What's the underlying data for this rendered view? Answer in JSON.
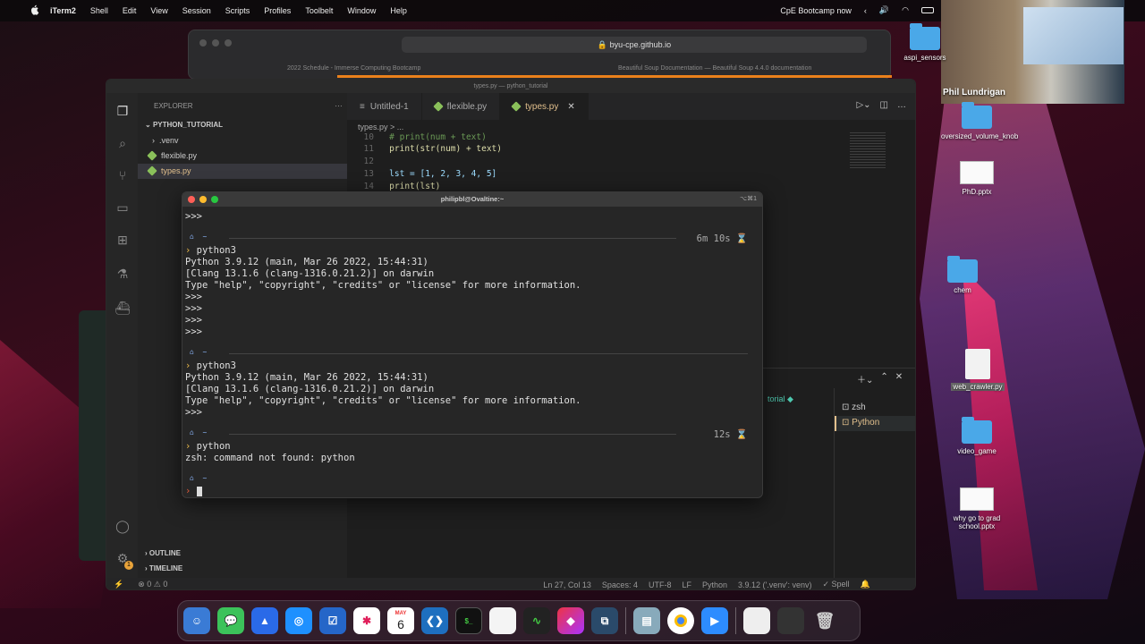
{
  "menubar": {
    "app": "iTerm2",
    "items": [
      "Shell",
      "Edit",
      "View",
      "Session",
      "Scripts",
      "Profiles",
      "Toolbelt",
      "Window",
      "Help"
    ],
    "status": "CpE Bootcamp now"
  },
  "safari": {
    "url": "byu-cpe.github.io",
    "tabs": [
      "2022 Schedule - Immerse Computing Bootcamp",
      "Beautiful Soup Documentation — Beautiful Soup 4.4.0 documentation"
    ]
  },
  "vscode": {
    "window_title": "types.py — python_tutorial",
    "explorer_label": "EXPLORER",
    "project": "PYTHON_TUTORIAL",
    "files": [
      ".venv",
      "flexible.py",
      "types.py"
    ],
    "tabs": [
      "Untitled-1",
      "flexible.py",
      "types.py"
    ],
    "breadcrumb": "types.py > ...",
    "code_lines": [
      {
        "num": "10",
        "text": "# print(num + text)"
      },
      {
        "num": "11",
        "text": "print(str(num) + text)"
      },
      {
        "num": "12",
        "text": ""
      },
      {
        "num": "13",
        "text": "lst = [1, 2, 3, 4, 5]"
      },
      {
        "num": "14",
        "text": "print(lst)"
      }
    ],
    "outline": "OUTLINE",
    "timeline": "TIMELINE",
    "terminals": [
      "zsh",
      "Python"
    ],
    "partial_label": "torial",
    "status": {
      "errors": "0",
      "warnings": "0",
      "position": "Ln 27, Col 13",
      "spaces": "Spaces: 4",
      "encoding": "UTF-8",
      "eol": "LF",
      "language": "Python",
      "interpreter": "3.9.12 ('.venv': venv)",
      "spell": "Spell"
    },
    "badge": "1"
  },
  "iterm": {
    "title": "philipbl@Ovaltine:~",
    "shortcut": "⌥⌘1",
    "lines": [
      ">>>",
      "python3",
      "Python 3.9.12 (main, Mar 26 2022, 15:44:31)",
      "[Clang 13.1.6 (clang-1316.0.21.2)] on darwin",
      "Type \"help\", \"copyright\", \"credits\" or \"license\" for more information.",
      ">>>",
      ">>>",
      ">>>",
      ">>>",
      "python3",
      "Python 3.9.12 (main, Mar 26 2022, 15:44:31)",
      "[Clang 13.1.6 (clang-1316.0.21.2)] on darwin",
      "Type \"help\", \"copyright\", \"credits\" or \"license\" for more information.",
      ">>>",
      "python",
      "zsh: command not found: python"
    ],
    "elapsed": [
      "6m 10s",
      "12s"
    ],
    "home": "~"
  },
  "desktop": {
    "icons": [
      "aspi_sensors",
      "oversized_volume_knob",
      "PhD.pptx",
      "chem",
      "web_crawler.py",
      "video_game",
      "why go to grad school.pptx"
    ]
  },
  "webcam": {
    "name": "Phil Lundrigan"
  },
  "dock": {
    "calendar_month": "MAY",
    "calendar_day": "6"
  }
}
